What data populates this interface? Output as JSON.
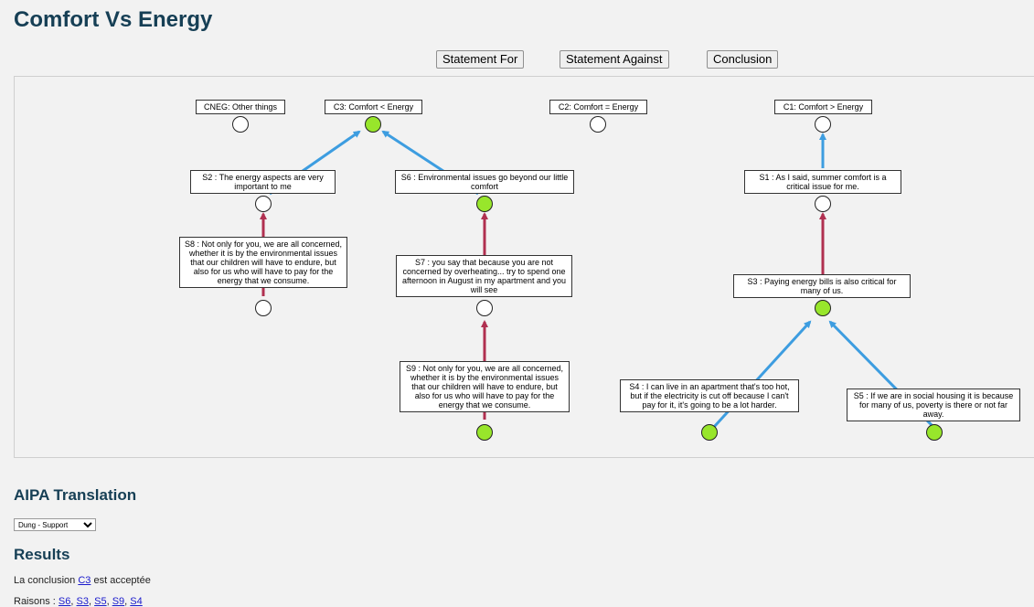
{
  "page": {
    "title": "Comfort Vs Energy"
  },
  "toolbar": {
    "statement_for": "Statement For",
    "statement_against": "Statement Against",
    "conclusion": "Conclusion"
  },
  "colors": {
    "support": "#3d9de0",
    "attack": "#b03050",
    "accepted": "#98e62b"
  },
  "graph": {
    "conclusions": {
      "cneg": "CNEG: Other things",
      "c3": "C3: Comfort < Energy",
      "c2": "C2: Comfort = Energy",
      "c1": "C1: Comfort > Energy"
    },
    "statements": {
      "s2": "S2 : The energy aspects are very important to me",
      "s6": "S6 : Environmental issues go beyond our little comfort",
      "s1": "S1 : As I said, summer comfort is a critical issue for me.",
      "s8": "S8 : Not only for you, we are all concerned, whether it is by the environmental issues that our children will have to endure, but also for us who will have to pay for the energy that we consume.",
      "s7": "S7 : you say that because you are not concerned by overheating... try to spend one afternoon in August in my apartment and you will see",
      "s3": "S3 : Paying energy bills is also critical for many of us.",
      "s9": "S9 : Not only for you, we are all concerned, whether it is by the environmental issues that our children will have to endure, but also for us who will have to pay for the energy that we consume.",
      "s4": "S4 : I can live in an apartment that's too hot, but if the electricity is cut off because I can't pay for it, it's going to be a lot harder.",
      "s5": "S5 : If we are in social housing it is because for many of us, poverty is there or not far away."
    }
  },
  "aipa": {
    "heading": "AIPA Translation",
    "selected": "Dung - Support"
  },
  "results": {
    "heading": "Results",
    "conclusion_prefix": "La conclusion",
    "conclusion_link": "C3",
    "conclusion_suffix": "est acceptée",
    "reasons_prefix": "Raisons :",
    "reasons": [
      "S6",
      "S3",
      "S5",
      "S9",
      "S4"
    ]
  }
}
